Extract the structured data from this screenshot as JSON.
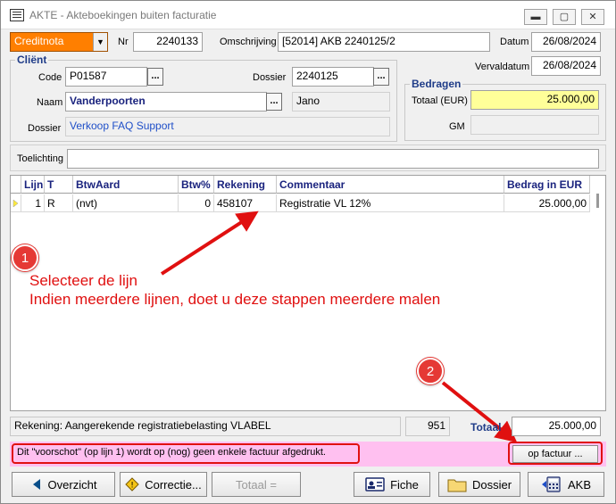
{
  "window": {
    "title": "AKTE - Akteboekingen buiten facturatie",
    "controls": {
      "minimize": "▬",
      "maximize": "▢",
      "close": "✕"
    }
  },
  "header": {
    "type_value": "Creditnota",
    "nr_label": "Nr",
    "nr_value": "2240133",
    "omschrijving_label": "Omschrijving",
    "omschrijving_value": "[52014] AKB 2240125/2",
    "datum_label": "Datum",
    "datum_value": "26/08/2024",
    "vervaldatum_label": "Vervaldatum",
    "vervaldatum_value": "26/08/2024"
  },
  "client": {
    "group_title": "Cliënt",
    "code_label": "Code",
    "code_value": "P01587",
    "dossier_label": "Dossier",
    "dossier_value": "2240125",
    "naam_label": "Naam",
    "naam_value": "Vanderpoorten",
    "naam_extra": "Jano",
    "dossier2_label": "Dossier",
    "dossier2_value": "Verkoop FAQ Support",
    "lookup": "..."
  },
  "bedragen": {
    "group_title": "Bedragen",
    "totaal_label": "Totaal (EUR)",
    "totaal_value": "25.000,00",
    "gm_label": "GM",
    "gm_value": ""
  },
  "toelichting": {
    "label": "Toelichting",
    "value": ""
  },
  "grid": {
    "columns": [
      "Lijn",
      "T",
      "BtwAard",
      "Btw%",
      "Rekening",
      "Commentaar",
      "Bedrag in EUR"
    ],
    "rows": [
      {
        "lijn": "1",
        "t": "R",
        "btwaard": "(nvt)",
        "btw": "0",
        "rekening": "458107",
        "commentaar": "Registratie VL 12%",
        "bedrag": "25.000,00"
      }
    ]
  },
  "footer": {
    "rekening_text": "Rekening: Aangerekende registratiebelasting VLABEL",
    "count": "951",
    "totaal_label": "Totaal",
    "totaal_value": "25.000,00",
    "warning_text": "Dit \"voorschot\" (op lijn 1) wordt op (nog) geen enkele factuur afgedrukt.",
    "op_factuur_button": "op factuur ..."
  },
  "buttons": {
    "overzicht": "Overzicht",
    "correctie": "Correctie...",
    "totaal": "Totaal =",
    "fiche": "Fiche",
    "dossier": "Dossier",
    "akb": "AKB"
  },
  "annotations": {
    "badge1": "1",
    "badge2": "2",
    "line1": "Selecteer de lijn",
    "line2": "Indien meerdere lijnen, doet u deze stappen meerdere malen"
  },
  "colors": {
    "type_bg": "#ff7f00",
    "totaal_bg": "#ffff99",
    "warning_bg": "#ffc0f0",
    "annotation": "#e01010",
    "header_text": "#1a237e"
  }
}
